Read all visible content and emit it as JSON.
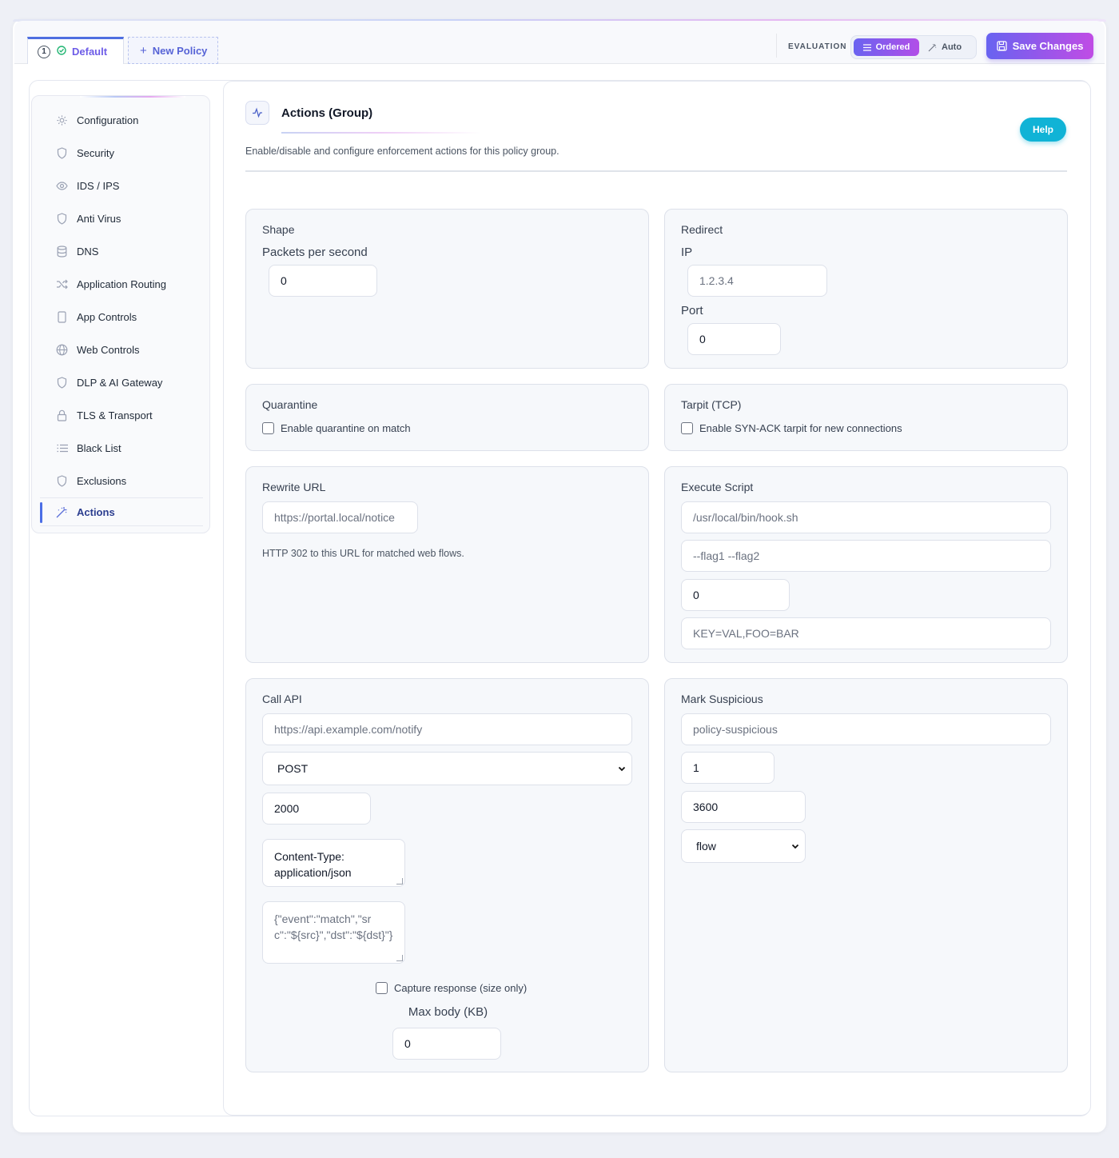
{
  "tabs": {
    "default": {
      "number": "1",
      "label": "Default"
    },
    "new_policy": {
      "label": "New Policy"
    }
  },
  "evaluation": {
    "label": "EVALUATION",
    "ordered": "Ordered",
    "auto": "Auto"
  },
  "save_button": "Save Changes",
  "sidebar": {
    "items": [
      {
        "label": "Configuration",
        "icon": "gear-icon"
      },
      {
        "label": "Security",
        "icon": "shield-icon"
      },
      {
        "label": "IDS / IPS",
        "icon": "eye-icon"
      },
      {
        "label": "Anti Virus",
        "icon": "shield-icon"
      },
      {
        "label": "DNS",
        "icon": "database-icon"
      },
      {
        "label": "Application Routing",
        "icon": "shuffle-icon"
      },
      {
        "label": "App Controls",
        "icon": "device-icon"
      },
      {
        "label": "Web Controls",
        "icon": "globe-icon"
      },
      {
        "label": "DLP & AI Gateway",
        "icon": "shield-icon"
      },
      {
        "label": "TLS & Transport",
        "icon": "lock-icon"
      },
      {
        "label": "Black List",
        "icon": "list-icon"
      },
      {
        "label": "Exclusions",
        "icon": "shield-icon"
      },
      {
        "label": "Actions",
        "icon": "wand-icon",
        "active": true
      }
    ]
  },
  "header": {
    "title": "Actions (Group)",
    "description": "Enable/disable and configure enforcement actions for this policy group.",
    "help": "Help"
  },
  "shape": {
    "title": "Shape",
    "pps_label": "Packets per second",
    "pps_value": "0"
  },
  "redirect": {
    "title": "Redirect",
    "ip_label": "IP",
    "ip_placeholder": "1.2.3.4",
    "port_label": "Port",
    "port_value": "0"
  },
  "quarantine": {
    "title": "Quarantine",
    "checkbox_label": "Enable quarantine on match"
  },
  "tarpit": {
    "title": "Tarpit (TCP)",
    "checkbox_label": "Enable SYN-ACK tarpit for new connections"
  },
  "rewrite_url": {
    "title": "Rewrite URL",
    "placeholder": "https://portal.local/notice",
    "hint": "HTTP 302 to this URL for matched web flows."
  },
  "execute_script": {
    "title": "Execute Script",
    "path_placeholder": "/usr/local/bin/hook.sh",
    "args_placeholder": "--flag1 --flag2",
    "timeout_value": "0",
    "env_placeholder": "KEY=VAL,FOO=BAR"
  },
  "call_api": {
    "title": "Call API",
    "url_placeholder": "https://api.example.com/notify",
    "method": "POST",
    "timeout_value": "2000",
    "headers_value": "Content-Type: application/json",
    "body_placeholder": "{\"event\":\"match\",\"src\":\"${src}\",\"dst\":\"${dst}\"}",
    "capture_label": "Capture response (size only)",
    "max_body_label": "Max body (KB)",
    "max_body_value": "0"
  },
  "mark_suspicious": {
    "title": "Mark Suspicious",
    "tag_placeholder": "policy-suspicious",
    "score_value": "1",
    "ttl_value": "3600",
    "scope": "flow"
  }
}
